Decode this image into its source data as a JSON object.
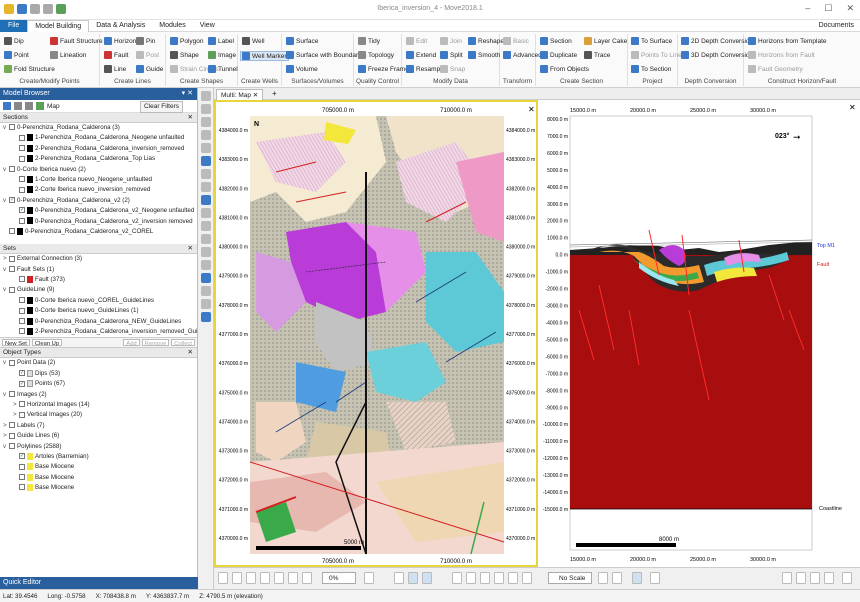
{
  "window": {
    "title": "Iberica_inversion_4 - Move2018.1"
  },
  "menu": {
    "file": "File",
    "items": [
      "Model Building",
      "Data & Analysis",
      "Modules",
      "View"
    ],
    "documents": "Documents"
  },
  "ribbon": {
    "create_points": {
      "caption": "Create/Modify Points",
      "items": [
        "Dip",
        "Point",
        "Fold Structure",
        "Fault Structure",
        "Lineation"
      ]
    },
    "create_lines": {
      "caption": "Create Lines",
      "items": [
        "Horizon",
        "Fault",
        "Line",
        "Pin",
        "Post",
        "Guide"
      ]
    },
    "create_shapes": {
      "caption": "Create Shapes",
      "items": [
        "Polygon",
        "Shape",
        "Strain Circles",
        "Label",
        "Image",
        "Tunnel"
      ]
    },
    "create_wells": {
      "caption": "Create Wells",
      "items": [
        "Well",
        "Well Marker"
      ]
    },
    "surfaces": {
      "caption": "Surfaces/Volumes",
      "items": [
        "Surface",
        "Surface with Boundaries",
        "Volume"
      ]
    },
    "quality": {
      "caption": "Quality Control",
      "items": [
        "Tidy",
        "Topology",
        "Freeze Frame"
      ]
    },
    "modify": {
      "caption": "Modify Data",
      "items": [
        "Edit",
        "Join",
        "Reshape",
        "Extend",
        "Split",
        "Smooth",
        "Resample",
        "Snap"
      ]
    },
    "transform": {
      "caption": "Transform",
      "items": [
        "Basic",
        "Advanced"
      ]
    },
    "create_section": {
      "caption": "Create Section",
      "items": [
        "Section",
        "Layer Cake",
        "Duplicate",
        "Trace",
        "From Objects"
      ]
    },
    "project": {
      "caption": "Project",
      "items": [
        "To Surface",
        "Points To Line",
        "To Section"
      ]
    },
    "depth": {
      "caption": "Depth Conversion",
      "items": [
        "2D Depth Conversion",
        "3D Depth Conversion"
      ]
    },
    "horizon": {
      "caption": "Construct Horizon/Fault",
      "items": [
        "Horizons from Template",
        "Horizons from Fault",
        "Fault Geometry"
      ]
    }
  },
  "model_browser": {
    "title": "Model Browser",
    "map_label": "Map",
    "clear_filters": "Clear Filters"
  },
  "sections": {
    "header": "Sections",
    "rows": [
      {
        "label": "0-Perenchiza_Rodana_Calderona (3)",
        "level": 0,
        "checked": false,
        "exp": "v"
      },
      {
        "label": "1-Perenchiza_Rodana_Calderona_Neogene unfaulted",
        "level": 1,
        "checked": false,
        "swatch": "#000000"
      },
      {
        "label": "2-Perenchiza_Rodana_Calderona_inversion_removed",
        "level": 1,
        "checked": false,
        "swatch": "#000000"
      },
      {
        "label": "2-Perenchiza_Rodana_Calderona_Top Lias",
        "level": 1,
        "checked": false,
        "swatch": "#000000"
      },
      {
        "label": "0-Corte Iberica nuevo (2)",
        "level": 0,
        "checked": false,
        "exp": "v"
      },
      {
        "label": "1-Corte Iberica nuevo_Neogene_unfaulted",
        "level": 1,
        "checked": false,
        "swatch": "#000000"
      },
      {
        "label": "2-Corte Iberica nuevo_inversion_removed",
        "level": 1,
        "checked": false,
        "swatch": "#000000"
      },
      {
        "label": "0-Perenchiza_Rodana_Calderona_v2 (2)",
        "level": 0,
        "checked": true,
        "exp": "v"
      },
      {
        "label": "0-Perenchiza_Rodana_Calderona_v2_Neogene unfaulted",
        "level": 1,
        "checked": true,
        "swatch": "#000000"
      },
      {
        "label": "0-Perenchiza_Rodana_Calderona_v2_inversion removed",
        "level": 1,
        "checked": false,
        "swatch": "#000000"
      },
      {
        "label": "0-Perenchiza_Rodana_Calderona_v2_COREL",
        "level": 0,
        "checked": false,
        "swatch": "#000000"
      }
    ]
  },
  "sets": {
    "header": "Sets",
    "rows": [
      {
        "label": "External Connection (3)",
        "level": 0,
        "checked": false,
        "exp": ">"
      },
      {
        "label": "Fault Sets (1)",
        "level": 0,
        "checked": false,
        "exp": "v"
      },
      {
        "label": "Fault (373)",
        "level": 1,
        "checked": false,
        "swatch": "#d42020"
      },
      {
        "label": "GuideLine (9)",
        "level": 0,
        "checked": false,
        "exp": "v"
      },
      {
        "label": "0-Corte Iberica nuevo_COREL_GuideLines",
        "level": 1,
        "checked": false,
        "swatch": "#000000"
      },
      {
        "label": "0-Corte Iberica nuevo_GuideLines (1)",
        "level": 1,
        "checked": false,
        "swatch": "#000000"
      },
      {
        "label": "0-Perenchiza_Rodana_Calderona_NEW_GuideLines",
        "level": 1,
        "checked": false,
        "swatch": "#000000"
      },
      {
        "label": "2-Perenchiza_Rodana_Calderona_inversion_removed_GuideLines",
        "level": 1,
        "checked": false,
        "swatch": "#000000"
      }
    ],
    "buttons": [
      "New Set",
      "Clean Up",
      "Add",
      "Remove",
      "Collect"
    ]
  },
  "object_types": {
    "header": "Object Types",
    "rows": [
      {
        "label": "Point Data (2)",
        "level": 0,
        "checked": false,
        "exp": "v"
      },
      {
        "label": "Dips (53)",
        "level": 1,
        "checked": true,
        "swatch": ""
      },
      {
        "label": "Points (67)",
        "level": 1,
        "checked": true,
        "swatch": ""
      },
      {
        "label": "Images (2)",
        "level": 0,
        "checked": false,
        "exp": "v"
      },
      {
        "label": "Horizontal Images (14)",
        "level": 1,
        "checked": false,
        "exp": ">"
      },
      {
        "label": "Vertical Images (20)",
        "level": 1,
        "checked": false,
        "exp": ">"
      },
      {
        "label": "Labels (7)",
        "level": 0,
        "checked": false,
        "exp": ">"
      },
      {
        "label": "Guide Lines (6)",
        "level": 0,
        "checked": false,
        "exp": ">"
      },
      {
        "label": "Polylines (2588)",
        "level": 0,
        "checked": false,
        "exp": "v"
      },
      {
        "label": "Artoles (Barremian)",
        "level": 1,
        "checked": true,
        "swatch": "#f2e73a"
      },
      {
        "label": "Base Miocene",
        "level": 1,
        "checked": false,
        "swatch": "#f2e73a"
      },
      {
        "label": "Base Miocene",
        "level": 1,
        "checked": false,
        "swatch": "#f2e73a"
      },
      {
        "label": "Base Miocene",
        "level": 1,
        "checked": false,
        "swatch": "#f2e73a"
      }
    ]
  },
  "quick_editor": "Quick Editor",
  "tab": {
    "label": "Multi: Map",
    "add": "+"
  },
  "map": {
    "top_x_ticks": [
      "705000.0 m",
      "710000.0 m"
    ],
    "bottom_x_ticks": [
      "705000.0 m",
      "710000.0 m"
    ],
    "y_ticks": [
      "4384000.0 m",
      "4383000.0 m",
      "4382000.0 m",
      "4381000.0 m",
      "4380000.0 m",
      "4379000.0 m",
      "4378000.0 m",
      "4377000.0 m",
      "4376000.0 m",
      "4375000.0 m",
      "4374000.0 m",
      "4373000.0 m",
      "4372000.0 m",
      "4371000.0 m",
      "4370000.0 m"
    ],
    "scale_label": "5000 m",
    "north": "N"
  },
  "section": {
    "x_ticks": [
      "15000.0 m",
      "20000.0 m",
      "25000.0 m",
      "30000.0 m"
    ],
    "y_ticks": [
      "8000.0 m",
      "7000.0 m",
      "6000.0 m",
      "5000.0 m",
      "4000.0 m",
      "3000.0 m",
      "2000.0 m",
      "1000.0 m",
      "0.0 m",
      "-1000.0 m",
      "-2000.0 m",
      "-3000.0 m",
      "-4000.0 m",
      "-5000.0 m",
      "-6000.0 m",
      "-7000.0 m",
      "-8000.0 m",
      "-9000.0 m",
      "-10000.0 m",
      "-11000.0 m",
      "-12000.0 m",
      "-13000.0 m",
      "-14000.0 m",
      "-15000.0 m"
    ],
    "azimuth": "023°",
    "labels": {
      "top_m1": "Top M1",
      "fault": "Fault",
      "coastline": "Coastline"
    },
    "scale_label": "8000 m"
  },
  "toolbar": {
    "zoom": "0%",
    "scale": "No Scale"
  },
  "status": {
    "lat": "Lat: 39.4546",
    "long": "Long: -0.5758",
    "x": "X: 708438.8 m",
    "y": "Y: 4363837.7 m",
    "z": "Z: 4790.5 m (elevation)"
  },
  "colors": {
    "accent": "#2a5f9e",
    "file": "#1e6fb5",
    "map_border": "#e8d53c",
    "basement": "#a80e0e"
  }
}
